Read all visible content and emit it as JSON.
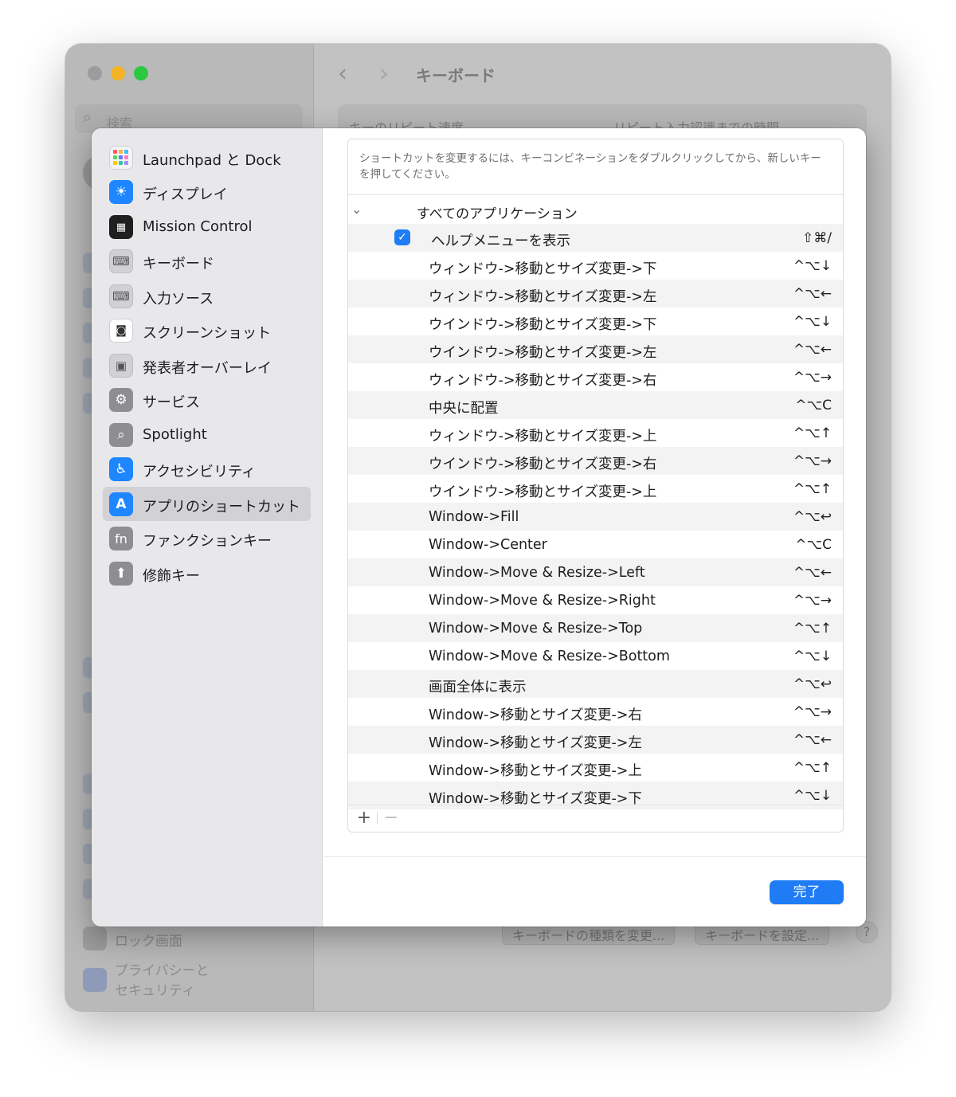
{
  "background_window": {
    "search_placeholder": "検索",
    "title": "キーボード",
    "labels": [
      "キーのリピート速度",
      "リピート入力認識までの時間"
    ],
    "buttons": [
      "キーボードの種類を変更...",
      "キーボードを設定..."
    ],
    "help": "?",
    "sidebar_bottom": [
      "ロック画面",
      "プライバシーと\nセキュリティ"
    ]
  },
  "sidebar": {
    "items": [
      {
        "label": "Launchpad と Dock",
        "icon": "launchpad-icon"
      },
      {
        "label": "ディスプレイ",
        "icon": "display-icon"
      },
      {
        "label": "Mission Control",
        "icon": "mission-control-icon"
      },
      {
        "label": "キーボード",
        "icon": "keyboard-icon"
      },
      {
        "label": "入力ソース",
        "icon": "input-source-icon"
      },
      {
        "label": "スクリーンショット",
        "icon": "screenshot-icon"
      },
      {
        "label": "発表者オーバーレイ",
        "icon": "presenter-overlay-icon"
      },
      {
        "label": "サービス",
        "icon": "services-icon"
      },
      {
        "label": "Spotlight",
        "icon": "spotlight-icon"
      },
      {
        "label": "アクセシビリティ",
        "icon": "accessibility-icon"
      },
      {
        "label": "アプリのショートカット",
        "icon": "app-shortcuts-icon",
        "selected": true
      },
      {
        "label": "ファンクションキー",
        "icon": "fn-key-icon"
      },
      {
        "label": "修飾キー",
        "icon": "modifier-key-icon"
      }
    ]
  },
  "shortcuts": {
    "hint": "ショートカットを変更するには、キーコンビネーションをダブルクリックしてから、新しいキーを押してください。",
    "group_label": "すべてのアプリケーション",
    "rows": [
      {
        "name": "ヘルプメニューを表示",
        "keys": "⇧⌘/",
        "checked": true
      },
      {
        "name": "ウィンドウ->移動とサイズ変更->下",
        "keys": "^⌥↓"
      },
      {
        "name": "ウィンドウ->移動とサイズ変更->左",
        "keys": "^⌥←"
      },
      {
        "name": "ウインドウ->移動とサイズ変更->下",
        "keys": "^⌥↓"
      },
      {
        "name": "ウインドウ->移動とサイズ変更->左",
        "keys": "^⌥←"
      },
      {
        "name": "ウィンドウ->移動とサイズ変更->右",
        "keys": "^⌥→"
      },
      {
        "name": "中央に配置",
        "keys": "^⌥C"
      },
      {
        "name": "ウィンドウ->移動とサイズ変更->上",
        "keys": "^⌥↑"
      },
      {
        "name": "ウインドウ->移動とサイズ変更->右",
        "keys": "^⌥→"
      },
      {
        "name": "ウインドウ->移動とサイズ変更->上",
        "keys": "^⌥↑"
      },
      {
        "name": "Window->Fill",
        "keys": "^⌥↩"
      },
      {
        "name": "Window->Center",
        "keys": "^⌥C"
      },
      {
        "name": "Window->Move & Resize->Left",
        "keys": "^⌥←"
      },
      {
        "name": "Window->Move & Resize->Right",
        "keys": "^⌥→"
      },
      {
        "name": "Window->Move & Resize->Top",
        "keys": "^⌥↑"
      },
      {
        "name": "Window->Move & Resize->Bottom",
        "keys": "^⌥↓"
      },
      {
        "name": "画面全体に表示",
        "keys": "^⌥↩"
      },
      {
        "name": "Window->移動とサイズ変更->右",
        "keys": "^⌥→"
      },
      {
        "name": "Window->移動とサイズ変更->左",
        "keys": "^⌥←"
      },
      {
        "name": "Window->移動とサイズ変更->上",
        "keys": "^⌥↑"
      },
      {
        "name": "Window->移動とサイズ変更->下",
        "keys": "^⌥↓"
      }
    ],
    "add_label": "+",
    "remove_label": "−"
  },
  "done_label": "完了",
  "colors": {
    "accent": "#1f7cf5",
    "selected_bg": "#d1d1d6"
  }
}
